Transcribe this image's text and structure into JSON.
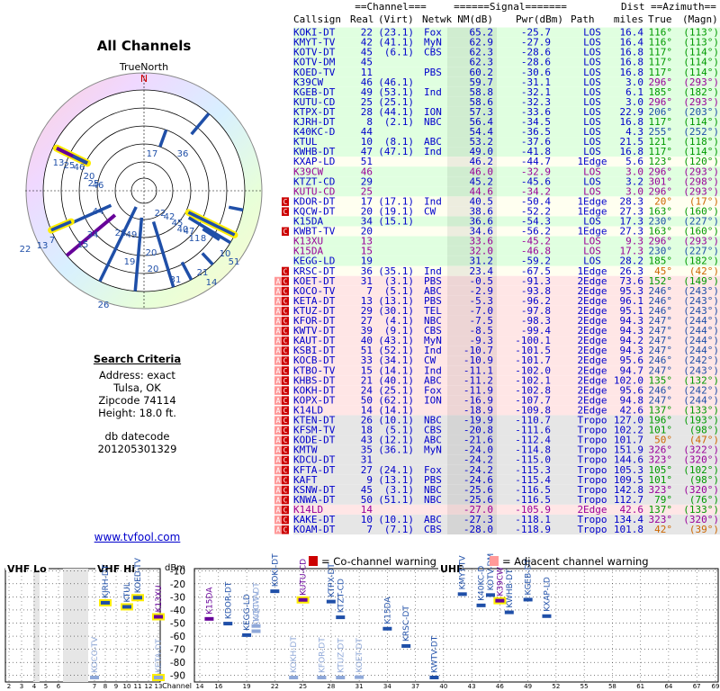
{
  "title": "All Channels",
  "polar": {
    "north_label": "TrueNorth",
    "n_letter": "N"
  },
  "search": {
    "heading": "Search Criteria",
    "address": "Address: exact",
    "city": "Tulsa, OK",
    "zip": "Zipcode 74114",
    "height": "Height: 18.0 ft.",
    "datecode_label": "db datecode",
    "datecode": "201205301329"
  },
  "website": "www.tvfool.com",
  "legend": {
    "cochannel": "= Co-channel warning",
    "adjacent": "= Adjacent channel warning"
  },
  "colors": {
    "digital": "#0000cc",
    "analog": "#990099",
    "los_bg": "#e0ffe0",
    "edge1_bg": "#fffff0",
    "edge2_bg": "#ffe6e6",
    "tropo_bg": "#e6e6e6",
    "cochannel": "#cc0000",
    "adjacent": "#ff9999",
    "azimuth_true": "#009900",
    "azimuth_magn": "#009900"
  },
  "table": {
    "group_headers": {
      "channel": "Channel",
      "signal": "Signal",
      "dist": "Dist",
      "azimuth": "Azimuth"
    },
    "headers": [
      "Callsign",
      "Real",
      "(Virt)",
      "Netwk",
      "NM(dB)",
      "Pwr(dBm)",
      "Path",
      "miles",
      "True",
      "(Magn)"
    ],
    "rows": [
      [
        "KOKI-DT",
        "22",
        "(23.1)",
        "Fox",
        "65.2",
        "-25.7",
        "LOS",
        "16.4",
        "116°",
        "(113°)"
      ],
      [
        "KMYT-TV",
        "42",
        "(41.1)",
        "MyN",
        "62.9",
        "-27.9",
        "LOS",
        "16.4",
        "116°",
        "(113°)"
      ],
      [
        "KOTV-DT",
        "45",
        "(6.1)",
        "CBS",
        "62.3",
        "-28.6",
        "LOS",
        "16.8",
        "117°",
        "(114°)"
      ],
      [
        "KOTV-DM",
        "45",
        "",
        "",
        "62.3",
        "-28.6",
        "LOS",
        "16.8",
        "117°",
        "(114°)"
      ],
      [
        "KOED-TV",
        "11",
        "",
        "PBS",
        "60.2",
        "-30.6",
        "LOS",
        "16.8",
        "117°",
        "(114°)"
      ],
      [
        "K39CW",
        "46",
        "(46.1)",
        "",
        "59.7",
        "-31.1",
        "LOS",
        "3.0",
        "296°",
        "(293°)"
      ],
      [
        "KGEB-DT",
        "49",
        "(53.1)",
        "Ind",
        "58.8",
        "-32.1",
        "LOS",
        "6.1",
        "185°",
        "(182°)"
      ],
      [
        "KUTU-CD",
        "25",
        "(25.1)",
        "",
        "58.6",
        "-32.3",
        "LOS",
        "3.0",
        "296°",
        "(293°)"
      ],
      [
        "KTPX-DT",
        "28",
        "(44.1)",
        "ION",
        "57.3",
        "-33.6",
        "LOS",
        "22.9",
        "206°",
        "(203°)"
      ],
      [
        "KJRH-DT",
        "8",
        "(2.1)",
        "NBC",
        "56.4",
        "-34.5",
        "LOS",
        "16.8",
        "117°",
        "(114°)"
      ],
      [
        "K40KC-D",
        "44",
        "",
        "",
        "54.4",
        "-36.5",
        "LOS",
        "4.3",
        "255°",
        "(252°)"
      ],
      [
        "KTUL",
        "10",
        "(8.1)",
        "ABC",
        "53.2",
        "-37.6",
        "LOS",
        "21.5",
        "121°",
        "(118°)"
      ],
      [
        "KWHB-DT",
        "47",
        "(47.1)",
        "Ind",
        "49.0",
        "-41.8",
        "LOS",
        "16.8",
        "117°",
        "(114°)"
      ],
      [
        "KXAP-LD",
        "51",
        "",
        "",
        "46.2",
        "-44.7",
        "1Edge",
        "5.6",
        "123°",
        "(120°)"
      ],
      [
        "K39CW",
        "46",
        "",
        "",
        "46.0",
        "-32.9",
        "LOS",
        "3.0",
        "296°",
        "(293°)"
      ],
      [
        "KTZT-CD",
        "29",
        "",
        "",
        "45.2",
        "-45.6",
        "LOS",
        "3.2",
        "301°",
        "(298°)"
      ],
      [
        "KUTU-CD",
        "25",
        "",
        "",
        "44.6",
        "-34.2",
        "LOS",
        "3.0",
        "296°",
        "(293°)"
      ],
      [
        "KDOR-DT",
        "17",
        "(17.1)",
        "Ind",
        "40.5",
        "-50.4",
        "1Edge",
        "28.3",
        "20°",
        "(17°)"
      ],
      [
        "KQCW-DT",
        "20",
        "(19.1)",
        "CW",
        "38.6",
        "-52.2",
        "1Edge",
        "27.3",
        "163°",
        "(160°)"
      ],
      [
        "K15DA",
        "34",
        "(15.1)",
        "",
        "36.6",
        "-54.3",
        "LOS",
        "17.3",
        "230°",
        "(227°)"
      ],
      [
        "KWBT-TV",
        "20",
        "",
        "",
        "34.6",
        "-56.2",
        "1Edge",
        "27.3",
        "163°",
        "(160°)"
      ],
      [
        "K13XU",
        "13",
        "",
        "",
        "33.6",
        "-45.2",
        "LOS",
        "9.3",
        "296°",
        "(293°)"
      ],
      [
        "K15DA",
        "15",
        "",
        "",
        "32.0",
        "-46.8",
        "LOS",
        "17.3",
        "230°",
        "(227°)"
      ],
      [
        "KEGG-LD",
        "19",
        "",
        "",
        "31.2",
        "-59.2",
        "LOS",
        "28.2",
        "185°",
        "(182°)"
      ],
      [
        "KRSC-DT",
        "36",
        "(35.1)",
        "Ind",
        "23.4",
        "-67.5",
        "1Edge",
        "26.3",
        "45°",
        "(42°)"
      ],
      [
        "KOET-DT",
        "31",
        "(3.1)",
        "PBS",
        "-0.5",
        "-91.3",
        "2Edge",
        "73.6",
        "152°",
        "(149°)"
      ],
      [
        "KOCO-TV",
        "7",
        "(5.1)",
        "ABC",
        "-2.9",
        "-93.8",
        "2Edge",
        "95.3",
        "246°",
        "(243°)"
      ],
      [
        "KETA-DT",
        "13",
        "(13.1)",
        "PBS",
        "-5.3",
        "-96.2",
        "2Edge",
        "96.1",
        "246°",
        "(243°)"
      ],
      [
        "KTUZ-DT",
        "29",
        "(30.1)",
        "TEL",
        "-7.0",
        "-97.8",
        "2Edge",
        "95.1",
        "246°",
        "(243°)"
      ],
      [
        "KFOR-DT",
        "27",
        "(4.1)",
        "NBC",
        "-7.5",
        "-98.3",
        "2Edge",
        "94.3",
        "247°",
        "(244°)"
      ],
      [
        "KWTV-DT",
        "39",
        "(9.1)",
        "CBS",
        "-8.5",
        "-99.4",
        "2Edge",
        "94.3",
        "247°",
        "(244°)"
      ],
      [
        "KAUT-DT",
        "40",
        "(43.1)",
        "MyN",
        "-9.3",
        "-100.1",
        "2Edge",
        "94.2",
        "247°",
        "(244°)"
      ],
      [
        "KSBI-DT",
        "51",
        "(52.1)",
        "Ind",
        "-10.7",
        "-101.5",
        "2Edge",
        "94.3",
        "247°",
        "(244°)"
      ],
      [
        "KOCB-DT",
        "33",
        "(34.1)",
        "CW",
        "-10.9",
        "-101.7",
        "2Edge",
        "95.6",
        "246°",
        "(242°)"
      ],
      [
        "KTBO-TV",
        "15",
        "(14.1)",
        "Ind",
        "-11.1",
        "-102.0",
        "2Edge",
        "94.7",
        "247°",
        "(243°)"
      ],
      [
        "KHBS-DT",
        "21",
        "(40.1)",
        "ABC",
        "-11.2",
        "-102.1",
        "2Edge",
        "102.0",
        "135°",
        "(132°)"
      ],
      [
        "KOKH-DT",
        "24",
        "(25.1)",
        "Fox",
        "-11.9",
        "-102.8",
        "2Edge",
        "95.6",
        "246°",
        "(242°)"
      ],
      [
        "KOPX-DT",
        "50",
        "(62.1)",
        "ION",
        "-16.9",
        "-107.7",
        "2Edge",
        "94.8",
        "247°",
        "(244°)"
      ],
      [
        "K14LD",
        "14",
        "(14.1)",
        "",
        "-18.9",
        "-109.8",
        "2Edge",
        "42.6",
        "137°",
        "(133°)"
      ],
      [
        "KTEN-DT",
        "26",
        "(10.1)",
        "NBC",
        "-19.9",
        "-110.7",
        "Tropo",
        "127.0",
        "196°",
        "(193°)"
      ],
      [
        "KFSM-TV",
        "18",
        "(5.1)",
        "CBS",
        "-20.8",
        "-111.6",
        "Tropo",
        "102.2",
        "101°",
        "(98°)"
      ],
      [
        "KODE-DT",
        "43",
        "(12.1)",
        "ABC",
        "-21.6",
        "-112.4",
        "Tropo",
        "101.7",
        "50°",
        "(47°)"
      ],
      [
        "KMTW",
        "35",
        "(36.1)",
        "MyN",
        "-24.0",
        "-114.8",
        "Tropo",
        "151.9",
        "326°",
        "(322°)"
      ],
      [
        "KDCU-DT",
        "31",
        "",
        "",
        "-24.2",
        "-115.0",
        "Tropo",
        "144.6",
        "323°",
        "(320°)"
      ],
      [
        "KFTA-DT",
        "27",
        "(24.1)",
        "Fox",
        "-24.2",
        "-115.3",
        "Tropo",
        "105.3",
        "105°",
        "(102°)"
      ],
      [
        "KAFT",
        "9",
        "(13.1)",
        "PBS",
        "-24.6",
        "-115.4",
        "Tropo",
        "109.5",
        "101°",
        "(98°)"
      ],
      [
        "KSNW-DT",
        "45",
        "(3.1)",
        "NBC",
        "-25.6",
        "-116.5",
        "Tropo",
        "142.8",
        "323°",
        "(320°)"
      ],
      [
        "KNWA-DT",
        "50",
        "(51.1)",
        "NBC",
        "-25.6",
        "-116.5",
        "Tropo",
        "112.7",
        "79°",
        "(76°)"
      ],
      [
        "K14LD",
        "14",
        "",
        "",
        "-27.0",
        "-105.9",
        "2Edge",
        "42.6",
        "137°",
        "(133°)"
      ],
      [
        "KAKE-DT",
        "10",
        "(10.1)",
        "ABC",
        "-27.3",
        "-118.1",
        "Tropo",
        "134.4",
        "323°",
        "(320°)"
      ],
      [
        "KOAM-DT",
        "7",
        "(7.1)",
        "CBS",
        "-28.0",
        "-118.9",
        "Tropo",
        "101.8",
        "42°",
        "(39°)"
      ]
    ],
    "analog_rows": [
      14,
      16,
      21,
      22,
      48
    ],
    "warnings": [
      "",
      "",
      "",
      "",
      "",
      "",
      "",
      "",
      "",
      "",
      "",
      "",
      "",
      "",
      "",
      "",
      "",
      "C",
      "C",
      "",
      "C",
      "",
      "",
      "",
      "C",
      "CA",
      "CA",
      "CA",
      "CA",
      "CA",
      "CA",
      "CA",
      "CA",
      "CA",
      "CA",
      "CA",
      "CA",
      "CA",
      "CA",
      "CA",
      "CA",
      "CA",
      "CA",
      "CA",
      "CA",
      "CA",
      "CA",
      "CA",
      "CA",
      "CA",
      "CA"
    ]
  },
  "chart_data": {
    "type": "bar",
    "title": "",
    "ylabel": "dBm",
    "xlabel": "Channel",
    "ylim": [
      -95,
      -5
    ],
    "yticks": [
      -10,
      -20,
      -30,
      -40,
      -50,
      -60,
      -70,
      -80,
      -90
    ],
    "bands": [
      {
        "name": "VHF Lo",
        "channels": [
          2,
          6
        ]
      },
      {
        "name": "VHF Hi",
        "channels": [
          7,
          13
        ]
      },
      {
        "name": "UHF",
        "channels": [
          14,
          69
        ]
      }
    ],
    "xticks": [
      2,
      3,
      4,
      5,
      6,
      7,
      8,
      9,
      10,
      11,
      12,
      13,
      14,
      16,
      19,
      22,
      25,
      28,
      31,
      34,
      37,
      40,
      43,
      46,
      49,
      52,
      55,
      58,
      61,
      64,
      67,
      69
    ],
    "stations": [
      {
        "label": "KJRH-DT",
        "ch": 8,
        "dbm": -34.5,
        "type": "digital",
        "hl": true
      },
      {
        "label": "KTUL",
        "ch": 10,
        "dbm": -37.6,
        "type": "digital",
        "hl": true
      },
      {
        "label": "KOED-TV",
        "ch": 11,
        "dbm": -30.6,
        "type": "digital",
        "hl": true
      },
      {
        "label": "K13XU",
        "ch": 13,
        "dbm": -45.2,
        "type": "analog",
        "hl": true
      },
      {
        "label": "KOCO-TV",
        "ch": 7,
        "dbm": -93.8,
        "type": "weak",
        "hl": false
      },
      {
        "label": "KETA-DT",
        "ch": 13,
        "dbm": -96.2,
        "type": "weak",
        "hl": true
      },
      {
        "label": "K15DA",
        "ch": 15,
        "dbm": -46.8,
        "type": "analog",
        "hl": false
      },
      {
        "label": "KDOR-DT",
        "ch": 17,
        "dbm": -50.4,
        "type": "digital",
        "hl": false
      },
      {
        "label": "KEGG-LD",
        "ch": 19,
        "dbm": -59.2,
        "type": "digital",
        "hl": false
      },
      {
        "label": "KWBT-TV",
        "ch": 20,
        "dbm": -56.2,
        "type": "weak",
        "hl": false
      },
      {
        "label": "KQCW-DT",
        "ch": 20,
        "dbm": -52.2,
        "type": "weak",
        "hl": false
      },
      {
        "label": "KOKH-DT",
        "ch": 24,
        "dbm": -102.8,
        "type": "faint",
        "hl": false
      },
      {
        "label": "KOKI-DT",
        "ch": 22,
        "dbm": -25.7,
        "type": "digital",
        "hl": false
      },
      {
        "label": "KUTU-CD",
        "ch": 25,
        "dbm": -32.3,
        "type": "analog",
        "hl": true
      },
      {
        "label": "KFOR-DT",
        "ch": 27,
        "dbm": -98.3,
        "type": "faint",
        "hl": false
      },
      {
        "label": "KTPX-DT",
        "ch": 28,
        "dbm": -33.6,
        "type": "digital",
        "hl": false
      },
      {
        "label": "KTUZ-DT",
        "ch": 29,
        "dbm": -97.8,
        "type": "faint",
        "hl": false
      },
      {
        "label": "KTZT-CD",
        "ch": 29,
        "dbm": -45.6,
        "type": "digital",
        "hl": false
      },
      {
        "label": "KOET-DT",
        "ch": 31,
        "dbm": -91.3,
        "type": "faint",
        "hl": false
      },
      {
        "label": "K15DA",
        "ch": 34,
        "dbm": -54.3,
        "type": "digital",
        "hl": false
      },
      {
        "label": "KRSC-DT",
        "ch": 36,
        "dbm": -67.5,
        "type": "digital",
        "hl": false
      },
      {
        "label": "KWTV-DT",
        "ch": 39,
        "dbm": -99.4,
        "type": "digital",
        "hl": false
      },
      {
        "label": "KMYT-TV",
        "ch": 42,
        "dbm": -27.9,
        "type": "digital",
        "hl": false
      },
      {
        "label": "K40KC-D",
        "ch": 44,
        "dbm": -36.5,
        "type": "digital",
        "hl": false
      },
      {
        "label": "KOTV-DM",
        "ch": 45,
        "dbm": -28.6,
        "type": "digital",
        "hl": false
      },
      {
        "label": "K39CW",
        "ch": 46,
        "dbm": -32.9,
        "type": "analog",
        "hl": true
      },
      {
        "label": "KWHB-DT",
        "ch": 47,
        "dbm": -41.8,
        "type": "digital",
        "hl": false
      },
      {
        "label": "KGEB-DT",
        "ch": 49,
        "dbm": -32.1,
        "type": "digital",
        "hl": false
      },
      {
        "label": "KXAP-LD",
        "ch": 51,
        "dbm": -44.7,
        "type": "digital",
        "hl": false
      }
    ]
  }
}
